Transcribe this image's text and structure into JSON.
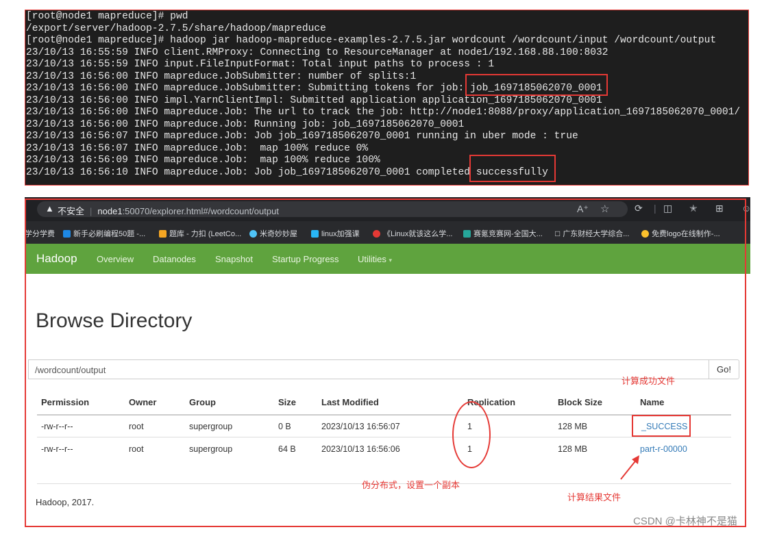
{
  "terminal": {
    "lines": [
      "[root@node1 mapreduce]# pwd",
      "/export/server/hadoop-2.7.5/share/hadoop/mapreduce",
      "[root@node1 mapreduce]# hadoop jar hadoop-mapreduce-examples-2.7.5.jar wordcount /wordcount/input /wordcount/output",
      "23/10/13 16:55:59 INFO client.RMProxy: Connecting to ResourceManager at node1/192.168.88.100:8032",
      "23/10/13 16:55:59 INFO input.FileInputFormat: Total input paths to process : 1",
      "23/10/13 16:56:00 INFO mapreduce.JobSubmitter: number of splits:1",
      "23/10/13 16:56:00 INFO mapreduce.JobSubmitter: Submitting tokens for job: job_1697185062070_0001",
      "23/10/13 16:56:00 INFO impl.YarnClientImpl: Submitted application application_1697185062070_0001",
      "23/10/13 16:56:00 INFO mapreduce.Job: The url to track the job: http://node1:8088/proxy/application_1697185062070_0001/",
      "23/10/13 16:56:00 INFO mapreduce.Job: Running job: job_1697185062070_0001",
      "23/10/13 16:56:07 INFO mapreduce.Job: Job job_1697185062070_0001 running in uber mode : true",
      "23/10/13 16:56:07 INFO mapreduce.Job:  map 100% reduce 0%",
      "23/10/13 16:56:09 INFO mapreduce.Job:  map 100% reduce 100%",
      "23/10/13 16:56:10 INFO mapreduce.Job: Job job_1697185062070_0001 completed successfully"
    ]
  },
  "browser": {
    "security_label": "不安全",
    "url_host": "node1",
    "url_rest": ":50070/explorer.html#/wordcount/output",
    "toolbar_icons": [
      "read-aloud-icon",
      "favorite-star-icon",
      "extensions-icon",
      "split-screen-icon",
      "favorites-icon",
      "collections-icon"
    ],
    "bookmarks": [
      {
        "label": "学分学费",
        "color": ""
      },
      {
        "label": "新手必刷编程50题 -...",
        "color": "#1e88e5"
      },
      {
        "label": "题库 - 力扣 (LeetCo...",
        "color": "#f5a623"
      },
      {
        "label": "米奇妙妙屋",
        "color": "#4fc3f7"
      },
      {
        "label": "linux加强课",
        "color": "#29b6f6"
      },
      {
        "label": "《Linux就该这么学...",
        "color": "#e53935"
      },
      {
        "label": "赛氪竞赛网-全国大...",
        "color": "#26a69a"
      },
      {
        "label": "广东财经大学综合...",
        "color": ""
      },
      {
        "label": "免费logo在线制作-...",
        "color": "#fbc02d"
      }
    ]
  },
  "hadoop": {
    "brand": "Hadoop",
    "nav": [
      "Overview",
      "Datanodes",
      "Snapshot",
      "Startup Progress",
      "Utilities"
    ],
    "title": "Browse Directory",
    "path": "/wordcount/output",
    "go_label": "Go!",
    "columns": [
      "Permission",
      "Owner",
      "Group",
      "Size",
      "Last Modified",
      "Replication",
      "Block Size",
      "Name"
    ],
    "rows": [
      {
        "permission": "-rw-r--r--",
        "owner": "root",
        "group": "supergroup",
        "size": "0 B",
        "modified": "2023/10/13 16:56:07",
        "replication": "1",
        "block_size": "128 MB",
        "name": "_SUCCESS"
      },
      {
        "permission": "-rw-r--r--",
        "owner": "root",
        "group": "supergroup",
        "size": "64 B",
        "modified": "2023/10/13 16:56:06",
        "replication": "1",
        "block_size": "128 MB",
        "name": "part-r-00000"
      }
    ],
    "footer": "Hadoop, 2017."
  },
  "annotations": {
    "success_file": "计算成功文件",
    "pseudo_distributed": "伪分布式，设置一个副本",
    "result_file": "计算结果文件"
  },
  "watermark": "CSDN @卡林神不是猫",
  "colors": {
    "annotation": "#e53935",
    "navbar": "#5fa33e",
    "link": "#337ab7"
  }
}
